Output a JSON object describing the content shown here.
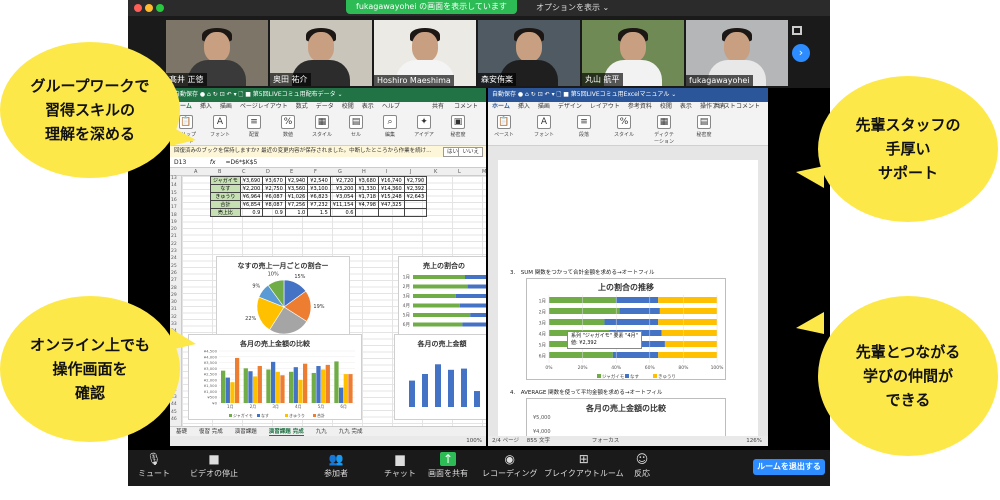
{
  "window": {
    "share_banner": "fukagawayohei の画面を表示しています",
    "view_options": "オプションを表示 ⌄"
  },
  "participants": [
    {
      "name": "髙井 正徳",
      "shirt": "#3a3a3a",
      "bg": "#7d7668"
    },
    {
      "name": "奥田 祐介",
      "shirt": "#2c2c2c",
      "bg": "#c9c5bb"
    },
    {
      "name": "Hoshiro Maeshima",
      "shirt": "#f4f4f4",
      "bg": "#eceae4"
    },
    {
      "name": "森安侑楽",
      "shirt": "#1f1f1f",
      "bg": "#4f5a62"
    },
    {
      "name": "丸山 航平",
      "shirt": "#f2f2f2",
      "bg": "#6f8a55"
    },
    {
      "name": "fukagawayohei",
      "shirt": "#e8e8e8",
      "bg": "#b4b6b8"
    }
  ],
  "excel": {
    "title": "自動保存 ●  ⌂ ↻ ⊡ ↶ ▾ 🗋 ■ 第5回LIVEコミュ用配布データ ⌄",
    "menu": [
      "ホーム",
      "挿入",
      "描画",
      "ページレイアウト",
      "数式",
      "データ",
      "校閲",
      "表示",
      "ヘルプ"
    ],
    "share_label": "共有",
    "comment_label": "コメント",
    "ribbon": [
      "クリップボード",
      "フォント",
      "配置",
      "数値",
      "スタイル",
      "セル",
      "編集",
      "アイデア",
      "秘密度"
    ],
    "notice": "回復済みのブックを保持しますか?  最近の変更内容が保存されました。中断したところから作業を続け…",
    "notice_yes": "はい",
    "notice_no": "いいえ",
    "cell_ref": "D13",
    "formula": "=D6*$K$5",
    "columns": [
      "A",
      "B",
      "C",
      "D",
      "E",
      "F",
      "G",
      "H",
      "I",
      "J",
      "K",
      "L",
      "M"
    ],
    "rows": [
      "13",
      "14",
      "15",
      "16",
      "17",
      "18",
      "19",
      "20",
      "21",
      "22",
      "23",
      "24",
      "25",
      "26",
      "27",
      "28",
      "29",
      "30",
      "31",
      "32",
      "33",
      "34",
      "35",
      "36",
      "37",
      "38",
      "39",
      "40",
      "41",
      "42",
      "43",
      "44",
      "45",
      "46"
    ],
    "table": [
      [
        "ジャガイモ",
        "¥3,690",
        "¥3,670",
        "¥2,940",
        "¥2,540",
        "¥2,720",
        "¥3,680",
        "¥16,740",
        "¥2,790"
      ],
      [
        "なす",
        "¥2,200",
        "¥2,750",
        "¥3,560",
        "¥3,100",
        "¥3,200",
        "¥1,330",
        "¥14,360",
        "¥2,392"
      ],
      [
        "きゅうり",
        "¥6,964",
        "¥6,087",
        "¥1,026",
        "¥6,823",
        "¥3,054",
        "¥1,718",
        "¥15,248",
        "¥2,643"
      ],
      [
        "合計",
        "¥6,854",
        "¥8,087",
        "¥7,256",
        "¥7,232",
        "¥11,154",
        "¥4,798",
        "¥47,325",
        ""
      ],
      [
        "売上比",
        "0.9",
        "0.9",
        "1.0",
        "1.5",
        "0.6",
        "",
        "",
        ""
      ]
    ],
    "pie_chart": {
      "title": "なすの売上一月ごとの割合ー"
    },
    "bar_h_title": "売上の割合の",
    "bar_v_title": "各月の売上金額の比較",
    "bar_v_title2": "各月の売上金額",
    "sheet_tabs": [
      "基礎",
      "復習 完成",
      "演習課題",
      "演習課題 完成",
      "九九",
      "九九 完成"
    ],
    "zoom_level": "100%"
  },
  "word": {
    "title": "自動保存 ●  ⌂ ↻ ⊡ ↶ ▾ 🗋 ■ 第5回LIVEコミュ用Excelマニュアル ⌄",
    "menu": [
      "ホーム",
      "挿入",
      "描画",
      "デザイン",
      "レイアウト",
      "参考資料",
      "校閲",
      "表示",
      "操作アシスト"
    ],
    "share_label": "共有",
    "comment_label": "コメント",
    "ribbon": [
      "ペースト",
      "フォント",
      "段落",
      "スタイル",
      "ディクテーション",
      "秘密度"
    ],
    "section3": "3.　SUM 関数をつかって合計金額を求める→オートフィル",
    "chart_title": "上の割合の推移",
    "tooltip_line1": "系列 \"ジャガイモ\" 要素 \"4月\"",
    "tooltip_line2": "値: ¥2,392",
    "axis_x": [
      "0%",
      "20%",
      "40%",
      "60%",
      "80%",
      "100%"
    ],
    "rows": [
      "1月",
      "2月",
      "3月",
      "4月",
      "5月",
      "6月"
    ],
    "legend": [
      "ジャガイモ",
      "なす",
      "きゅうり"
    ],
    "section4": "4.　AVERAGE 関数を使って平均金額を求める→オートフィル",
    "chart2_title": "各月の売上金額の比較",
    "chart2_y": [
      "¥5,000",
      "¥4,000"
    ],
    "status_page": "2/4 ページ",
    "status_words": "855 文字",
    "status_focus": "フォーカス",
    "status_zoom": "126%"
  },
  "toolbar": {
    "items": [
      "ミュート",
      "ビデオの停止",
      "参加者",
      "チャット",
      "画面を共有",
      "レコーディング",
      "ブレイクアウトルーム",
      "反応"
    ],
    "participant_count": "6",
    "leave": "ルームを退出する"
  },
  "callouts": {
    "top_left": "グループワークで\n習得スキルの\n理解を深める",
    "top_right": "先輩スタッフの\n手厚い\nサポート",
    "bottom_left": "オンライン上でも\n操作画面を\n確認",
    "bottom_right": "先輩とつながる\n学びの仲間が\nできる"
  },
  "colors": {
    "excel_green": "#217346",
    "word_blue": "#2b579a",
    "zoom_green": "#2dbb56",
    "zoom_blue": "#2d8cff",
    "callout_yellow": "#fde84a",
    "series_potato": "#70ad47",
    "series_eggplant": "#4472c4",
    "series_cucumber": "#ffc000",
    "series_total": "#ed7d31",
    "series_gray": "#a5a5a5"
  },
  "chart_data": [
    {
      "type": "pie",
      "title": "なすの売上一月ごとの割合ー",
      "categories": [
        "1月",
        "2月",
        "3月",
        "4月",
        "5月",
        "6月"
      ],
      "values": [
        15,
        19,
        25,
        22,
        9,
        10
      ],
      "data_labels": [
        "15%",
        "19%",
        "25%",
        "22%",
        "9%",
        "10%"
      ]
    },
    {
      "type": "bar",
      "title": "上の割合の推移",
      "orientation": "horizontal-stacked-100",
      "categories": [
        "1月",
        "2月",
        "3月",
        "4月",
        "5月",
        "6月"
      ],
      "series": [
        {
          "name": "ジャガイモ",
          "values": [
            40,
            42,
            33,
            36,
            44,
            38
          ]
        },
        {
          "name": "なす",
          "values": [
            25,
            24,
            32,
            31,
            25,
            27
          ]
        },
        {
          "name": "きゅうり",
          "values": [
            35,
            34,
            35,
            33,
            31,
            35
          ]
        }
      ],
      "xlim": [
        0,
        100
      ]
    },
    {
      "type": "bar",
      "title": "各月の売上金額の比較",
      "categories": [
        "1月",
        "2月",
        "3月",
        "4月",
        "5月",
        "6月"
      ],
      "series": [
        {
          "name": "ジャガイモ",
          "values": [
            2800,
            3000,
            2900,
            2700,
            2600,
            3600
          ]
        },
        {
          "name": "なす",
          "values": [
            2200,
            2750,
            3560,
            3100,
            3200,
            1330
          ]
        },
        {
          "name": "きゅうり",
          "values": [
            1800,
            2300,
            2700,
            2000,
            2900,
            2500
          ]
        },
        {
          "name": "合計",
          "values": [
            3900,
            3200,
            2400,
            3400,
            3300,
            2500
          ]
        }
      ],
      "y_ticks": [
        "¥0",
        "¥500",
        "¥1,000",
        "¥1,500",
        "¥2,000",
        "¥2,500",
        "¥3,000",
        "¥3,500",
        "¥4,000",
        "¥4,500"
      ],
      "ylim": [
        0,
        4500
      ]
    }
  ]
}
